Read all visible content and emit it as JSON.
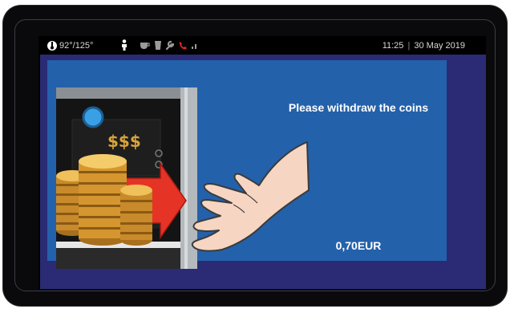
{
  "status_bar": {
    "temperature": "92°/125°",
    "time": "11:25",
    "separator": "|",
    "date": "30 May 2019",
    "icons": [
      "thermometer-icon",
      "person-icon",
      "cup-icon",
      "bucket-icon",
      "wrench-icon",
      "phone-icon",
      "signal-icon"
    ]
  },
  "main": {
    "message": "Please withdraw the coins",
    "amount": "0,70EUR"
  },
  "colors": {
    "content_blue": "#2461ab",
    "panel_navy": "#2a2b74",
    "coin_gold": "#d9a43a",
    "arrow_red": "#e53325"
  }
}
